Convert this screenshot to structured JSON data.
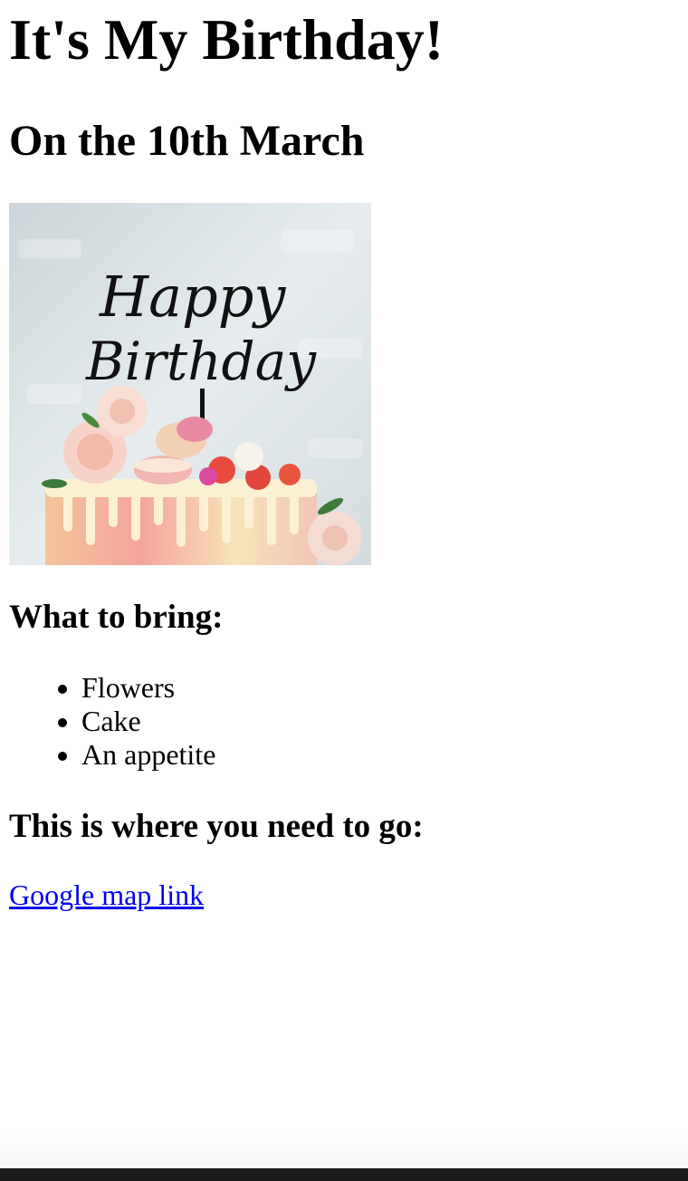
{
  "heading": "It's My Birthday!",
  "subheading": "On the 10th March",
  "image": {
    "topper_line1": "Happy",
    "topper_line2": "Birthday"
  },
  "bring_heading": "What to bring:",
  "bring_items": [
    "Flowers",
    "Cake",
    "An appetite"
  ],
  "where_heading": "This is where you need to go:",
  "map_link_label": "Google map link",
  "colors": {
    "link": "#0000ee",
    "text": "#000000",
    "background": "#ffffff"
  }
}
